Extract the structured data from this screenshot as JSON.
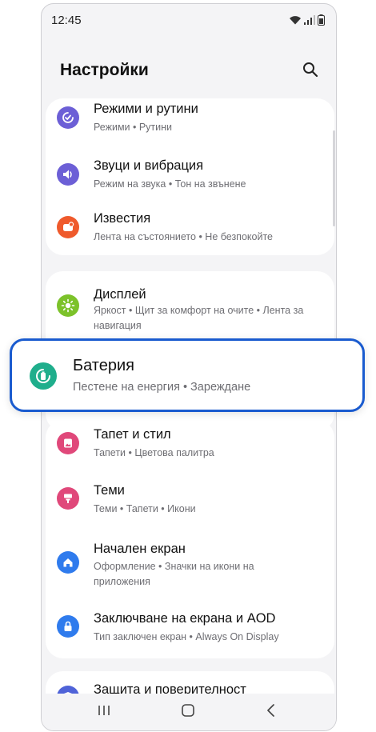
{
  "status_bar": {
    "time": "12:45"
  },
  "header": {
    "title": "Настройки"
  },
  "groups": [
    {
      "items": [
        {
          "title": "Режими и рутини",
          "subtitle": "Режими  •  Рутини",
          "icon": "modes-routines-icon",
          "color": "#6c5fd6"
        },
        {
          "title": "Звуци и вибрация",
          "subtitle": "Режим на звука  •  Тон на звънене",
          "icon": "sound-icon",
          "color": "#6c5fd6"
        },
        {
          "title": "Известия",
          "subtitle": "Лента на състоянието  •  Не безпокойте",
          "icon": "notifications-icon",
          "color": "#ef5a2c"
        }
      ]
    },
    {
      "items": [
        {
          "title": "Дисплей",
          "subtitle": "Яркост  •  Щит за комфорт на очите  •  Лента за навигация",
          "icon": "display-icon",
          "color": "#7cc22a"
        }
      ]
    },
    {
      "items": [
        {
          "title": "Тапет и стил",
          "subtitle": "Тапети  •  Цветова палитра",
          "icon": "wallpaper-icon",
          "color": "#e0487a"
        },
        {
          "title": "Теми",
          "subtitle": "Теми  •  Тапети  •  Икони",
          "icon": "themes-icon",
          "color": "#e0487a"
        },
        {
          "title": "Начален екран",
          "subtitle": "Оформление  •  Значки на икони на приложения",
          "icon": "home-screen-icon",
          "color": "#2f7bed"
        },
        {
          "title": "Заключване на екрана и AOD",
          "subtitle": "Тип заключен екран  •  Always On Display",
          "icon": "lock-icon",
          "color": "#2f7bed"
        }
      ]
    },
    {
      "items": [
        {
          "title": "Защита и поверителност",
          "subtitle": "",
          "icon": "privacy-icon",
          "color": "#4f63d8"
        }
      ]
    }
  ],
  "highlight": {
    "title": "Батерия",
    "subtitle": "Пестене на енергия  •  Зареждане",
    "icon": "battery-icon",
    "color": "#1fae8c",
    "border_color": "#1a5bcf"
  }
}
